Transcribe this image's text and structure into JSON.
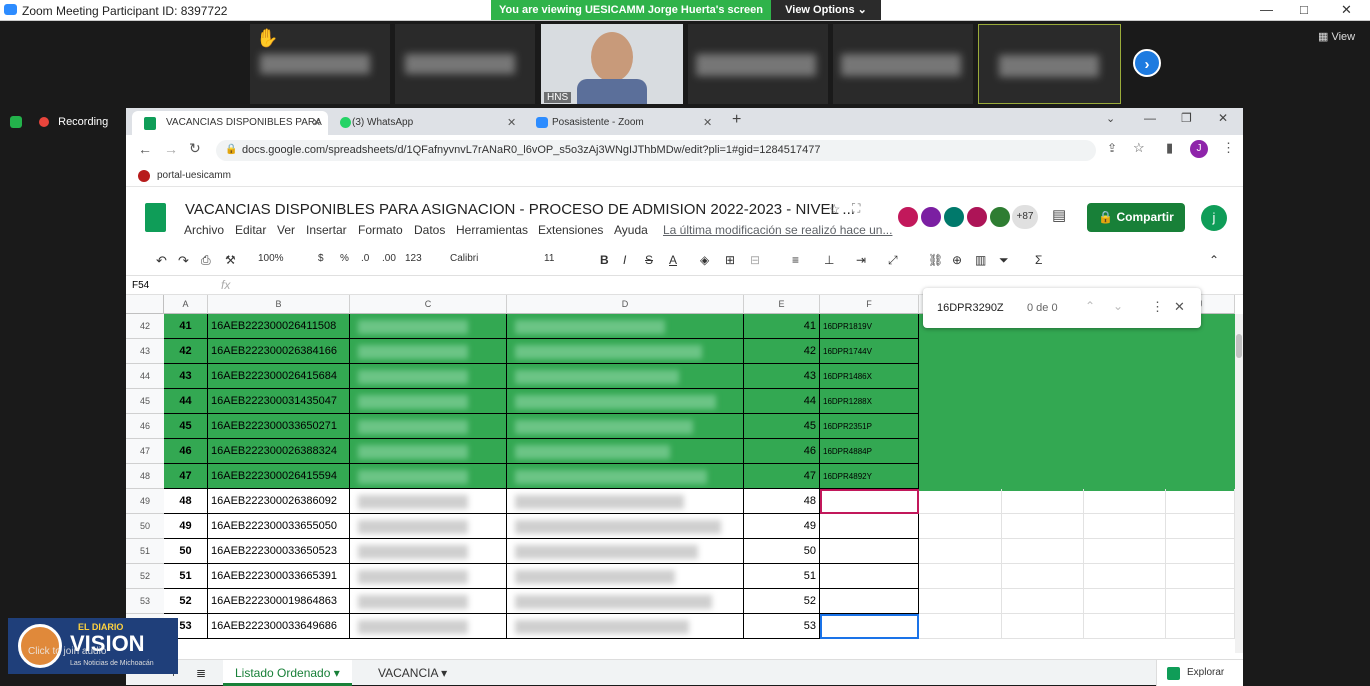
{
  "zoom": {
    "title": "Zoom Meeting Participant ID: 8397722",
    "viewing": "You are viewing UESICAMM Jorge Huerta's screen",
    "view_options": "View Options ⌄",
    "view_btn": "View",
    "recording": "Recording",
    "tile_hns": "HNS",
    "win_min": "—",
    "win_max": "□",
    "win_close": "✕",
    "next": "›"
  },
  "browser": {
    "tabs": [
      {
        "label": "VACANCIAS DISPONIBLES PARA"
      },
      {
        "label": "(3) WhatsApp"
      },
      {
        "label": "Posasistente - Zoom"
      }
    ],
    "new_tab": "+",
    "url": "docs.google.com/spreadsheets/d/1QFafnyvnvL7rANaR0_l6vOP_s5o3zAj3WNgIJThbMDw/edit?pli=1#gid=1284517477",
    "bookmark": "portal-uesicamm"
  },
  "sheet": {
    "title": "VACANCIAS DISPONIBLES PARA ASIGNACION - PROCESO DE ADMISION 2022-2023 - NIVEL ...",
    "menu": [
      "Archivo",
      "Editar",
      "Ver",
      "Insertar",
      "Formato",
      "Datos",
      "Herramientas",
      "Extensiones",
      "Ayuda"
    ],
    "last_modified": "La última modificación se realizó hace un...",
    "share": "Compartir",
    "user_initial": "j",
    "collab_count": "+87",
    "zoom": "100%",
    "currency": "$",
    "percent": "%",
    "dec1": ".0",
    "dec2": ".00",
    "fmt": "123",
    "font": "Calibri",
    "size": "11",
    "cellref": "F54",
    "fx": "fx",
    "find_text": "16DPR3290Z",
    "find_count": "0 de 0",
    "explore": "Explorar",
    "sheet_tabs": [
      "Listado Ordenado",
      "VACANCIA"
    ],
    "columns": [
      "A",
      "B",
      "C",
      "D",
      "E",
      "F",
      "",
      "",
      "",
      "J"
    ],
    "rows": [
      {
        "rn": "42",
        "a": "41",
        "b": "16AEB222300026411508",
        "e": "41",
        "f": "16DPR1819V",
        "green": true
      },
      {
        "rn": "43",
        "a": "42",
        "b": "16AEB222300026384166",
        "e": "42",
        "f": "16DPR1744V",
        "green": true
      },
      {
        "rn": "44",
        "a": "43",
        "b": "16AEB222300026415684",
        "e": "43",
        "f": "16DPR1486X",
        "green": true
      },
      {
        "rn": "45",
        "a": "44",
        "b": "16AEB222300031435047",
        "e": "44",
        "f": "16DPR1288X",
        "green": true
      },
      {
        "rn": "46",
        "a": "45",
        "b": "16AEB222300033650271",
        "e": "45",
        "f": "16DPR2351P",
        "green": true
      },
      {
        "rn": "47",
        "a": "46",
        "b": "16AEB222300026388324",
        "e": "46",
        "f": "16DPR4884P",
        "green": true
      },
      {
        "rn": "48",
        "a": "47",
        "b": "16AEB222300026415594",
        "e": "47",
        "f": "16DPR4892Y",
        "green": true
      },
      {
        "rn": "49",
        "a": "48",
        "b": "16AEB222300026386092",
        "e": "48",
        "f": "",
        "green": false
      },
      {
        "rn": "50",
        "a": "49",
        "b": "16AEB222300033655050",
        "e": "49",
        "f": "",
        "green": false
      },
      {
        "rn": "51",
        "a": "50",
        "b": "16AEB222300033650523",
        "e": "50",
        "f": "",
        "green": false
      },
      {
        "rn": "52",
        "a": "51",
        "b": "16AEB222300033665391",
        "e": "51",
        "f": "",
        "green": false
      },
      {
        "rn": "53",
        "a": "52",
        "b": "16AEB222300019864863",
        "e": "52",
        "f": "",
        "green": false
      },
      {
        "rn": "54",
        "a": "53",
        "b": "16AEB222300033649686",
        "e": "53",
        "f": "",
        "green": false
      }
    ]
  },
  "watermark": {
    "brand": "EL DIARIO",
    "name": "VISION",
    "tagline": "Las Noticias de Michoacán",
    "join_audio": "Click to join audio"
  }
}
